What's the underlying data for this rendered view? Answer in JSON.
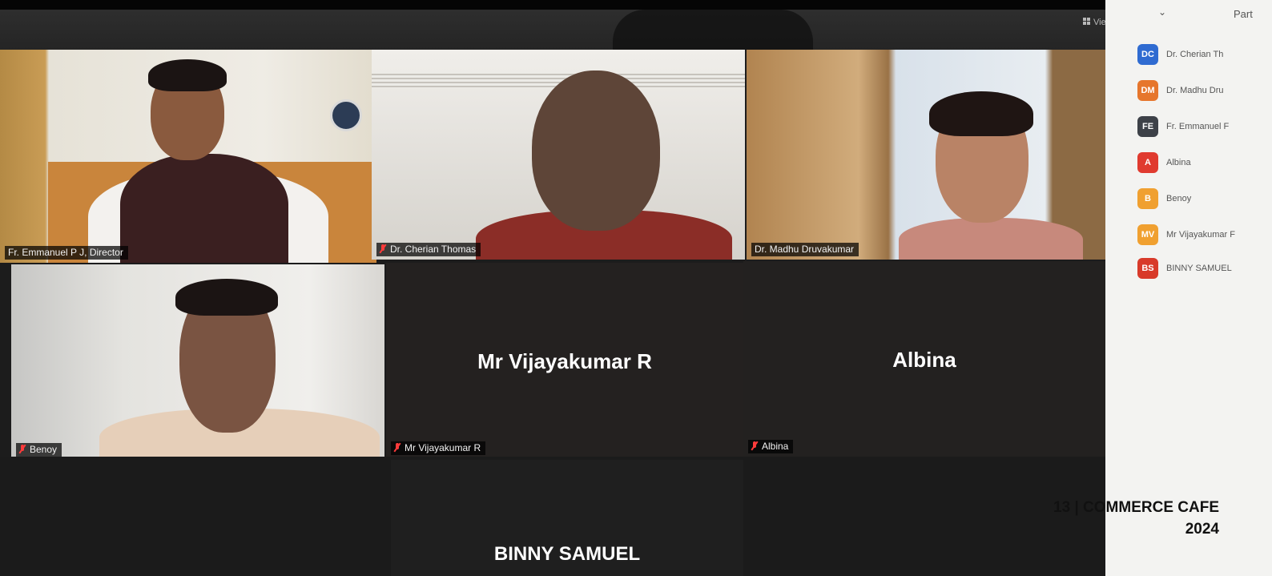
{
  "window": {
    "view_label": "View"
  },
  "participants_panel": {
    "title": "Part",
    "collapse_icon": "chevron-down-icon",
    "items": [
      {
        "initials": "DC",
        "name": "Dr. Cherian Th",
        "color": "#2f6bd1"
      },
      {
        "initials": "DM",
        "name": "Dr. Madhu Dru",
        "color": "#e6762c"
      },
      {
        "initials": "FE",
        "name": "Fr. Emmanuel F",
        "color": "#3d4148"
      },
      {
        "initials": "A",
        "name": "Albina",
        "color": "#e03a2f"
      },
      {
        "initials": "B",
        "name": "Benoy",
        "color": "#f0a030"
      },
      {
        "initials": "MV",
        "name": "Mr Vijayakumar F",
        "color": "#f0a030"
      },
      {
        "initials": "BS",
        "name": "BINNY SAMUEL",
        "color": "#d83a2a"
      }
    ]
  },
  "tiles": {
    "t1": {
      "name": "Fr. Emmanuel P J, Director"
    },
    "t2": {
      "name": "Dr. Cherian Thomas"
    },
    "t3": {
      "name": "Dr. Madhu Druvakumar"
    },
    "t4": {
      "name": "Benoy"
    },
    "t5": {
      "name": "Mr Vijayakumar R",
      "center": "Mr Vijayakumar R"
    },
    "t6": {
      "name": "Albina",
      "center": "Albina"
    },
    "t7": {
      "center": "BINNY SAMUEL"
    }
  },
  "caption": {
    "line1": "13 | COMMERCE CAFE",
    "line2": "2024"
  }
}
